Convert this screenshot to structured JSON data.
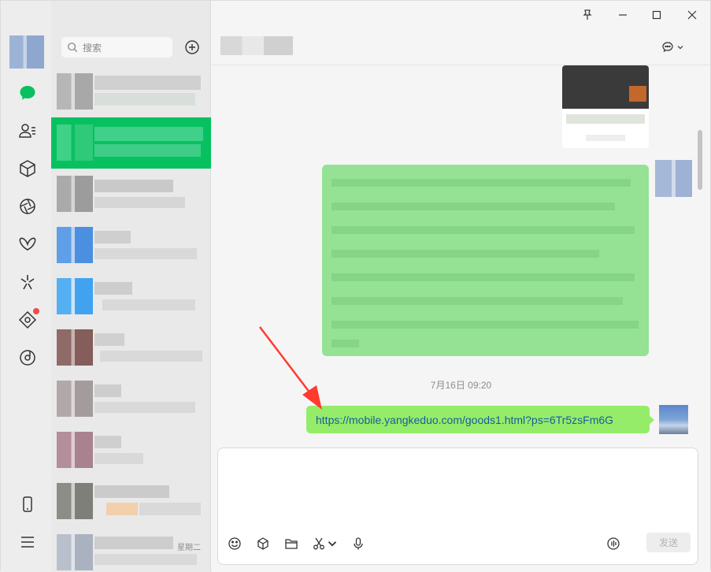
{
  "window": {
    "controls": [
      "pin",
      "minimize",
      "maximize",
      "close"
    ]
  },
  "rail": {
    "items": [
      {
        "name": "chats",
        "icon": "chat-bubble-icon",
        "active": true
      },
      {
        "name": "contacts",
        "icon": "contacts-icon"
      },
      {
        "name": "favorites",
        "icon": "cube-icon"
      },
      {
        "name": "moments",
        "icon": "aperture-icon"
      },
      {
        "name": "channels",
        "icon": "butterfly-icon"
      },
      {
        "name": "discover",
        "icon": "sparkle-icon"
      },
      {
        "name": "mini-programs",
        "icon": "diamond-icon",
        "badge": true
      },
      {
        "name": "listen",
        "icon": "music-disc-icon"
      }
    ],
    "bottom": [
      {
        "name": "phone",
        "icon": "phone-icon"
      },
      {
        "name": "menu",
        "icon": "menu-icon"
      }
    ],
    "accent": "#07c160"
  },
  "search": {
    "placeholder": "搜索"
  },
  "chat_list": {
    "last_item_day": "星期二"
  },
  "conversation": {
    "timestamp": "7月16日 09:20",
    "link_text": "https://mobile.yangkeduo.com/goods1.html?ps=6Tr5zsFm6G"
  },
  "input": {
    "send_label": "发送"
  },
  "colors": {
    "bubble_green": "#95ec69",
    "selected_row": "#07c160",
    "link": "#1a5c9c",
    "arrow": "#ff3b30"
  }
}
